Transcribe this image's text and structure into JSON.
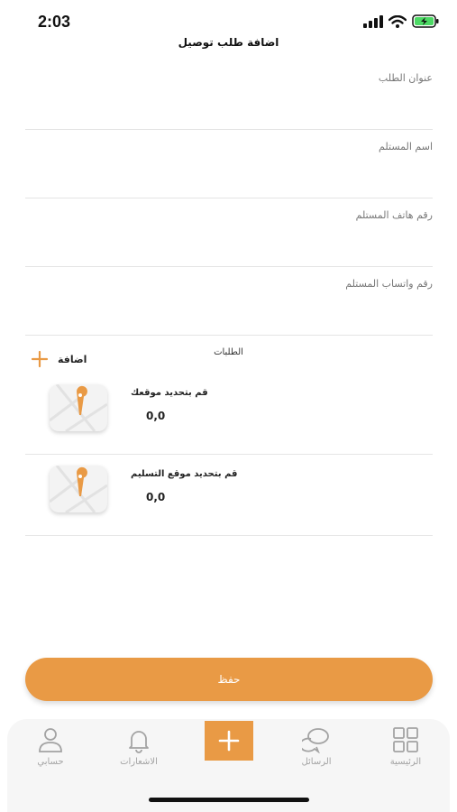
{
  "status_bar": {
    "time": "2:03",
    "icons": [
      "signal-icon",
      "wifi-icon",
      "battery-charging-icon"
    ]
  },
  "page": {
    "title": "اضافة طلب توصيل"
  },
  "form": {
    "fields": [
      {
        "label": "عنوان الطلب",
        "value": ""
      },
      {
        "label": "اسم المستلم",
        "value": ""
      },
      {
        "label": "رقم هاتف المستلم",
        "value": ""
      },
      {
        "label": "رقم واتساب المستلم",
        "value": ""
      }
    ]
  },
  "orders": {
    "section_title": "الطلبات",
    "add_label": "اضافة",
    "locations": [
      {
        "title": "قم بتحديد موقعك",
        "value": "0,0",
        "icon": "map-pin-icon"
      },
      {
        "title": "قم بتحديد موقع التسليم",
        "value": "0,0",
        "icon": "map-pin-icon"
      }
    ]
  },
  "save_button": {
    "label": "حفظ"
  },
  "nav": {
    "items": [
      {
        "label": "حسابي",
        "icon": "user-icon"
      },
      {
        "label": "الاشعارات",
        "icon": "bell-icon"
      },
      {
        "label": "",
        "icon": "plus-icon"
      },
      {
        "label": "الرسائل",
        "icon": "chat-icon"
      },
      {
        "label": "الرئيسية",
        "icon": "grid-icon"
      }
    ]
  },
  "colors": {
    "accent": "#e99a45",
    "nav_icon": "#a3a3a3",
    "divider": "#e4e4e4"
  }
}
